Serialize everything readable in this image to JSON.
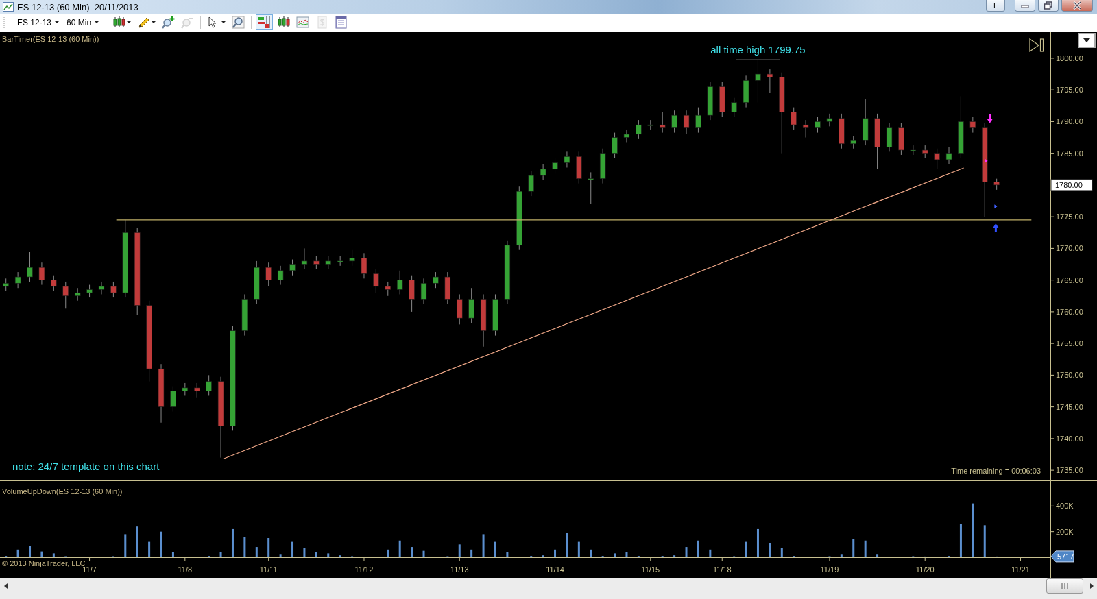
{
  "window": {
    "title": "ES 12-13 (60 Min)  20/11/2013",
    "buttons": [
      {
        "kind": "text",
        "label": "L"
      },
      {
        "kind": "minimize"
      },
      {
        "kind": "restore"
      },
      {
        "kind": "close"
      }
    ]
  },
  "toolbar": {
    "instrument": "ES 12-13",
    "interval": "60 Min",
    "tools": [
      {
        "kind": "candles",
        "caret": true,
        "disabled": false
      },
      {
        "kind": "pencil",
        "caret": true,
        "disabled": false
      },
      {
        "kind": "zoom-in",
        "caret": false,
        "disabled": false
      },
      {
        "kind": "zoom-out",
        "caret": false,
        "disabled": true
      },
      {
        "kind": "pointer",
        "caret": true,
        "disabled": false
      },
      {
        "kind": "magnifier",
        "caret": false,
        "disabled": false
      }
    ],
    "toggles": [
      {
        "kind": "data-box",
        "on": true,
        "disabled": false
      },
      {
        "kind": "chart-style",
        "on": false,
        "disabled": false
      },
      {
        "kind": "indicators",
        "on": false,
        "disabled": false
      },
      {
        "kind": "dollar",
        "on": false,
        "disabled": true
      },
      {
        "kind": "properties",
        "on": false,
        "disabled": false
      }
    ]
  },
  "price_panel": {
    "indicator_label": "BarTimer(ES 12-13 (60 Min))",
    "note": "note: 24/7 template on this chart",
    "time_remaining": "Time remaining = 00:06:03",
    "chart_data": {
      "type": "candlestick",
      "categories": [
        null,
        null,
        null,
        null,
        null,
        null,
        null,
        null,
        null,
        null,
        null,
        null,
        null,
        null,
        null,
        null,
        null,
        null,
        null,
        null,
        null,
        null,
        null,
        null,
        null,
        null,
        null,
        null,
        null,
        null,
        null,
        null,
        null,
        null,
        null,
        null,
        null,
        null,
        null,
        null,
        null,
        null,
        null,
        null,
        null,
        null,
        null,
        null,
        null,
        null,
        null,
        null,
        null,
        null,
        null,
        null,
        null,
        null,
        null,
        null,
        null,
        null,
        null,
        null,
        null,
        null,
        null,
        null,
        null,
        null,
        null,
        null,
        null,
        null,
        null,
        null,
        null,
        null,
        null,
        null,
        null,
        null,
        null,
        null,
        null,
        null,
        null,
        null
      ],
      "ylim": [
        1733.5,
        1804.1
      ],
      "yticks": [
        {
          "value": 1735,
          "label": "1735.00"
        },
        {
          "value": 1740,
          "label": "1740.00"
        },
        {
          "value": 1745,
          "label": "1745.00"
        },
        {
          "value": 1750,
          "label": "1750.00"
        },
        {
          "value": 1755,
          "label": "1755.00"
        },
        {
          "value": 1760,
          "label": "1760.00"
        },
        {
          "value": 1765,
          "label": "1765.00"
        },
        {
          "value": 1770,
          "label": "1770.00"
        },
        {
          "value": 1775,
          "label": "1775.00"
        },
        {
          "value": 1780,
          "label": "1780.00"
        },
        {
          "value": 1785,
          "label": "1785.00"
        },
        {
          "value": 1790,
          "label": "1790.00"
        },
        {
          "value": 1795,
          "label": "1795.00"
        },
        {
          "value": 1800,
          "label": "1800.00"
        }
      ],
      "ohlc": [
        [
          1764,
          1765.25,
          1763.25,
          1764.5
        ],
        [
          1764.5,
          1766.25,
          1763.75,
          1765.5
        ],
        [
          1765.5,
          1769.5,
          1764.75,
          1767
        ],
        [
          1767,
          1767.75,
          1764.25,
          1765
        ],
        [
          1765,
          1765.75,
          1763.25,
          1764
        ],
        [
          1764,
          1764.75,
          1760.5,
          1762.5
        ],
        [
          1762.5,
          1763.75,
          1761.75,
          1763
        ],
        [
          1763,
          1764.25,
          1762.25,
          1763.5
        ],
        [
          1763.5,
          1764.75,
          1762.75,
          1764
        ],
        [
          1764,
          1764.75,
          1762.25,
          1763
        ],
        [
          1763,
          1774.5,
          1762.25,
          1772.5
        ],
        [
          1772.5,
          1773.25,
          1759.5,
          1761
        ],
        [
          1761,
          1761.75,
          1749,
          1751
        ],
        [
          1751,
          1751.75,
          1742.5,
          1745
        ],
        [
          1745,
          1748.25,
          1744.25,
          1747.5
        ],
        [
          1747.5,
          1748.75,
          1746.75,
          1748
        ],
        [
          1748,
          1748.75,
          1746.5,
          1747.5
        ],
        [
          1747.5,
          1750,
          1746.75,
          1749
        ],
        [
          1749,
          1749.75,
          1737,
          1742
        ],
        [
          1742,
          1757.75,
          1741.25,
          1757
        ],
        [
          1757,
          1762.75,
          1756.25,
          1762
        ],
        [
          1762,
          1768,
          1761.25,
          1767
        ],
        [
          1767,
          1767.75,
          1764,
          1765
        ],
        [
          1765,
          1767.25,
          1764.25,
          1766.5
        ],
        [
          1766.5,
          1768.25,
          1765.75,
          1767.5
        ],
        [
          1767.5,
          1770,
          1766.75,
          1768
        ],
        [
          1768,
          1768.75,
          1766.75,
          1767.5
        ],
        [
          1767.5,
          1768.75,
          1766.75,
          1768
        ],
        [
          1768,
          1768.75,
          1767.25,
          1768
        ],
        [
          1768,
          1769.75,
          1767.25,
          1768.5
        ],
        [
          1768.5,
          1769.25,
          1765.25,
          1766
        ],
        [
          1766,
          1766.75,
          1763,
          1764
        ],
        [
          1764,
          1764.75,
          1762.5,
          1763.5
        ],
        [
          1763.5,
          1766.5,
          1762.75,
          1765
        ],
        [
          1765,
          1765.75,
          1760,
          1762
        ],
        [
          1762,
          1765.25,
          1761.25,
          1764.5
        ],
        [
          1764.5,
          1766.25,
          1763.75,
          1765.5
        ],
        [
          1765.5,
          1766.25,
          1761.25,
          1762
        ],
        [
          1762,
          1762.75,
          1758,
          1759
        ],
        [
          1759,
          1763.75,
          1758.25,
          1762
        ],
        [
          1762,
          1762.75,
          1754.5,
          1757
        ],
        [
          1757,
          1762.75,
          1756.25,
          1762
        ],
        [
          1762,
          1771.25,
          1761.25,
          1770.5
        ],
        [
          1770.5,
          1779.75,
          1769.75,
          1779
        ],
        [
          1779,
          1782.25,
          1778.25,
          1781.5
        ],
        [
          1781.5,
          1783.25,
          1780.75,
          1782.5
        ],
        [
          1782.5,
          1784.25,
          1781.75,
          1783.5
        ],
        [
          1783.5,
          1785.25,
          1782.75,
          1784.5
        ],
        [
          1784.5,
          1785.25,
          1780.25,
          1781
        ],
        [
          1781,
          1782,
          1777,
          1781
        ],
        [
          1781,
          1785.75,
          1780.25,
          1785
        ],
        [
          1785,
          1788.25,
          1784.25,
          1787.5
        ],
        [
          1787.5,
          1788.75,
          1786.75,
          1788
        ],
        [
          1788,
          1790.25,
          1787.25,
          1789.5
        ],
        [
          1789.5,
          1790.25,
          1788.75,
          1789.5
        ],
        [
          1789.5,
          1791.5,
          1788.25,
          1789
        ],
        [
          1789,
          1791.75,
          1788.25,
          1791
        ],
        [
          1791,
          1791.75,
          1788,
          1789
        ],
        [
          1789,
          1792.25,
          1788.25,
          1791
        ],
        [
          1791,
          1796.25,
          1790.25,
          1795.5
        ],
        [
          1795.5,
          1796.25,
          1790.75,
          1791.5
        ],
        [
          1791.5,
          1793.75,
          1790.75,
          1793
        ],
        [
          1793,
          1797.25,
          1792.25,
          1796.5
        ],
        [
          1796.5,
          1799.75,
          1793,
          1797.5
        ],
        [
          1797.5,
          1798.25,
          1794.5,
          1797
        ],
        [
          1797,
          1797.75,
          1785,
          1791.5
        ],
        [
          1791.5,
          1792.25,
          1788.75,
          1789.5
        ],
        [
          1789.5,
          1790.25,
          1787.5,
          1789
        ],
        [
          1789,
          1790.75,
          1788.25,
          1790
        ],
        [
          1790,
          1791.25,
          1789.25,
          1790.5
        ],
        [
          1790.5,
          1791.25,
          1785.75,
          1786.5
        ],
        [
          1786.5,
          1787.75,
          1785.75,
          1787
        ],
        [
          1787,
          1793.5,
          1786.25,
          1790.5
        ],
        [
          1790.5,
          1791.25,
          1782.5,
          1786
        ],
        [
          1786,
          1789.75,
          1785.25,
          1789
        ],
        [
          1789,
          1789.75,
          1784.75,
          1785.5
        ],
        [
          1785.5,
          1786.25,
          1784.75,
          1785.5
        ],
        [
          1785.5,
          1786.25,
          1784.25,
          1785
        ],
        [
          1785,
          1785.75,
          1782.5,
          1784
        ],
        [
          1784,
          1786,
          1783.25,
          1785
        ],
        [
          1785,
          1794,
          1784.25,
          1790
        ],
        [
          1790,
          1790.75,
          1788.25,
          1789
        ],
        [
          1789,
          1789.75,
          1775,
          1780.5
        ],
        [
          1780.5,
          1781,
          1779.25,
          1780
        ],
        null,
        null,
        null,
        null
      ],
      "annotations": [
        "all time high 1799.75"
      ]
    }
  },
  "volume_panel": {
    "copyright": "© 2013 NinjaTrader, LLC",
    "chart_data": {
      "type": "bar",
      "title": "VolumeUpDown(ES 12-13 (60 Min))",
      "categories": [
        null,
        null,
        null,
        null,
        null,
        null,
        null,
        "11/7",
        null,
        null,
        null,
        null,
        null,
        null,
        null,
        "11/8",
        null,
        null,
        null,
        null,
        null,
        null,
        "11/11",
        null,
        null,
        null,
        null,
        null,
        null,
        null,
        "11/12",
        null,
        null,
        null,
        null,
        null,
        null,
        null,
        "11/13",
        null,
        null,
        null,
        null,
        null,
        null,
        null,
        "11/14",
        null,
        null,
        null,
        null,
        null,
        null,
        null,
        "11/15",
        null,
        null,
        null,
        null,
        null,
        "11/18",
        null,
        null,
        null,
        null,
        null,
        null,
        null,
        null,
        "11/19",
        null,
        null,
        null,
        null,
        null,
        null,
        null,
        "11/20",
        null,
        null,
        null,
        null,
        null,
        null,
        null,
        "11/21",
        null,
        null
      ],
      "ylim": [
        0,
        600
      ],
      "yticks": [
        {
          "value": 200,
          "label": "200K"
        },
        {
          "value": 400,
          "label": "400K"
        }
      ],
      "series": [
        {
          "color": "#5b8fcf",
          "values": [
            10,
            60,
            90,
            45,
            30,
            8,
            3,
            5,
            4,
            8,
            180,
            240,
            120,
            200,
            40,
            4,
            5,
            10,
            40,
            220,
            160,
            80,
            150,
            20,
            120,
            70,
            40,
            30,
            15,
            8,
            5,
            3,
            60,
            130,
            80,
            50,
            5,
            8,
            100,
            60,
            180,
            120,
            40,
            5,
            10,
            15,
            60,
            190,
            120,
            60,
            10,
            30,
            40,
            10,
            5,
            10,
            15,
            80,
            130,
            60,
            5,
            8,
            120,
            220,
            110,
            70,
            10,
            4,
            5,
            8,
            20,
            140,
            130,
            20,
            5,
            4,
            8,
            6,
            3,
            10,
            260,
            420,
            250,
            6,
            null,
            null,
            null,
            null
          ]
        }
      ],
      "annotations": [
        "5717"
      ]
    }
  }
}
